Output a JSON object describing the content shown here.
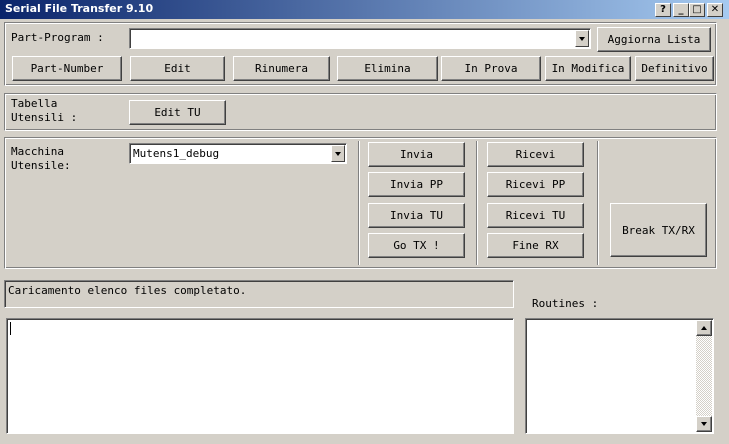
{
  "window": {
    "title": "Serial File Transfer 9.10",
    "help_label": "?",
    "minimize_label": "_",
    "maximize_label": "□",
    "close_label": "✕"
  },
  "program": {
    "label": "Part-Program :",
    "combo_value": "",
    "refresh_label": "Aggiorna Lista",
    "buttons": [
      "Part-Number",
      "Edit",
      "Rinumera",
      "Elimina",
      "In Prova",
      "In Modifica",
      "Definitivo"
    ]
  },
  "tools": {
    "label_line1": "Tabella",
    "label_line2": "Utensili :",
    "edit_label": "Edit TU"
  },
  "machine": {
    "label_line1": "Macchina",
    "label_line2": "Utensile:",
    "combo_value": "Mutens1_debug",
    "send": [
      "Invia",
      "Invia PP",
      "Invia TU",
      "Go TX !"
    ],
    "receive": [
      "Ricevi",
      "Ricevi PP",
      "Ricevi TU",
      "Fine RX"
    ],
    "break_label": "Break TX/RX"
  },
  "status": {
    "message": "Caricamento elenco files completato."
  },
  "log": {
    "text": ""
  },
  "routines": {
    "label": "Routines :"
  }
}
